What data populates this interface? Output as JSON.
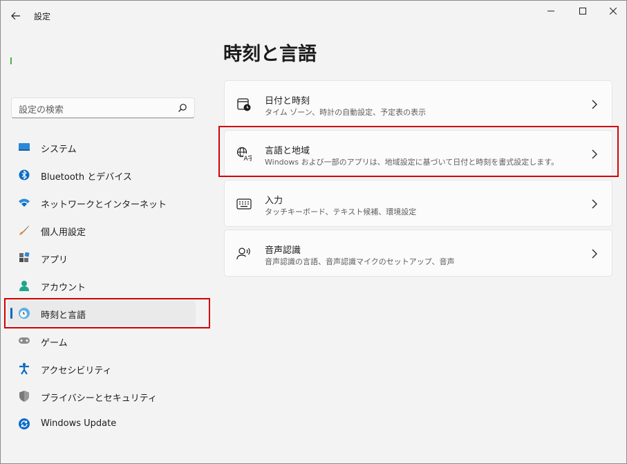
{
  "window": {
    "title": "設定"
  },
  "search": {
    "placeholder": "設定の検索"
  },
  "sidebar": {
    "items": [
      {
        "label": "システム",
        "icon": "system-icon"
      },
      {
        "label": "Bluetooth とデバイス",
        "icon": "bluetooth-icon"
      },
      {
        "label": "ネットワークとインターネット",
        "icon": "network-icon"
      },
      {
        "label": "個人用設定",
        "icon": "brush-icon"
      },
      {
        "label": "アプリ",
        "icon": "apps-icon"
      },
      {
        "label": "アカウント",
        "icon": "account-icon"
      },
      {
        "label": "時刻と言語",
        "icon": "time-language-icon",
        "selected": true
      },
      {
        "label": "ゲーム",
        "icon": "game-icon"
      },
      {
        "label": "アクセシビリティ",
        "icon": "accessibility-icon"
      },
      {
        "label": "プライバシーとセキュリティ",
        "icon": "shield-icon"
      },
      {
        "label": "Windows Update",
        "icon": "update-icon"
      }
    ]
  },
  "main": {
    "title": "時刻と言語",
    "cards": [
      {
        "title": "日付と時刻",
        "subtitle": "タイム ゾーン、時計の自動設定、予定表の表示",
        "icon": "clock-calendar-icon"
      },
      {
        "title": "言語と地域",
        "subtitle": "Windows および一部のアプリは、地域設定に基づいて日付と時刻を書式設定します。",
        "icon": "language-icon"
      },
      {
        "title": "入力",
        "subtitle": "タッチキーボード、テキスト候補、環境設定",
        "icon": "keyboard-icon"
      },
      {
        "title": "音声認識",
        "subtitle": "音声認識の言語、音声認識マイクのセットアップ、音声",
        "icon": "speech-icon"
      }
    ]
  },
  "colors": {
    "accent": "#0067c0",
    "highlight": "#d40000"
  }
}
